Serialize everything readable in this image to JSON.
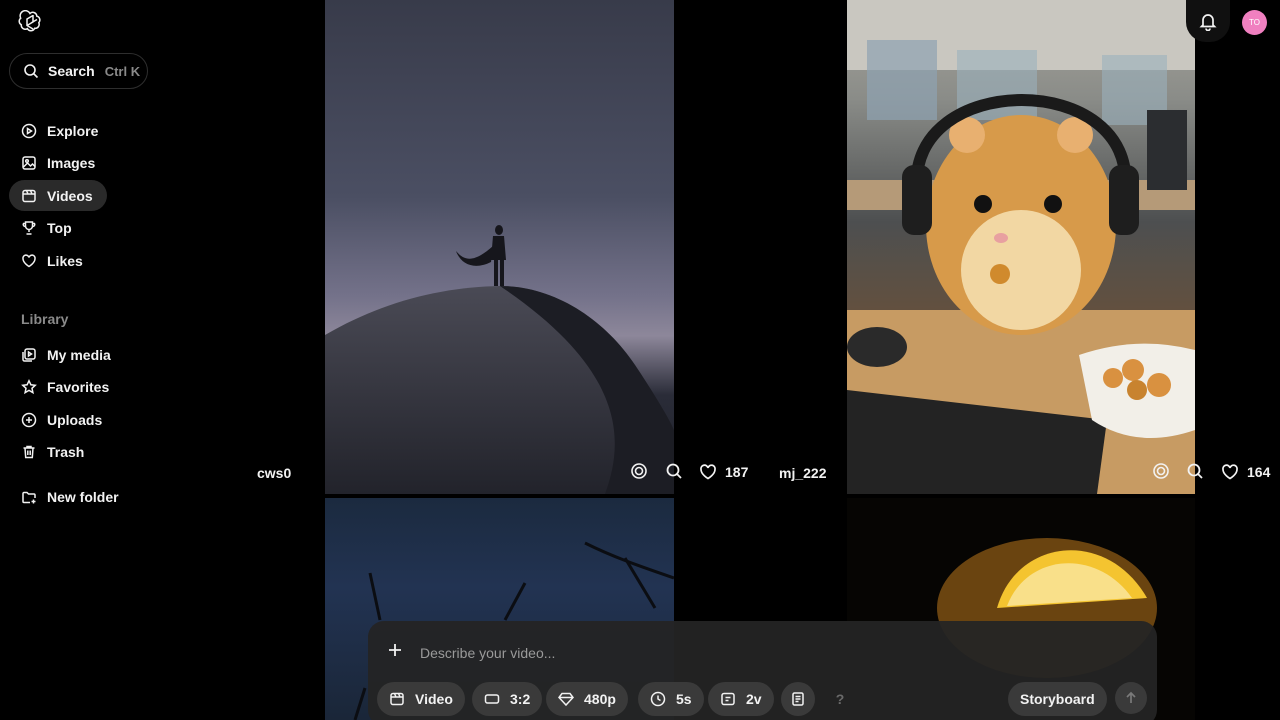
{
  "sidebar": {
    "search": {
      "label": "Search",
      "shortcut": "Ctrl K"
    },
    "items": [
      {
        "label": "Explore",
        "icon": "play-circle-icon"
      },
      {
        "label": "Images",
        "icon": "image-icon"
      },
      {
        "label": "Videos",
        "icon": "video-icon",
        "active": true
      },
      {
        "label": "Top",
        "icon": "trophy-icon"
      },
      {
        "label": "Likes",
        "icon": "heart-icon"
      }
    ],
    "library_label": "Library",
    "library_items": [
      {
        "label": "My media",
        "icon": "media-icon"
      },
      {
        "label": "Favorites",
        "icon": "star-icon"
      },
      {
        "label": "Uploads",
        "icon": "upload-icon"
      },
      {
        "label": "Trash",
        "icon": "trash-icon"
      }
    ],
    "new_folder": "New folder"
  },
  "feed": {
    "cards": [
      {
        "user": "cws0",
        "likes": "187"
      },
      {
        "user": "mj_222",
        "likes": "164"
      }
    ]
  },
  "header": {
    "avatar_initials": "TO",
    "avatar_color": "#f080c0"
  },
  "composer": {
    "placeholder": "Describe your video...",
    "type_label": "Video",
    "aspect_label": "3:2",
    "resolution_label": "480p",
    "duration_label": "5s",
    "variations_label": "2v",
    "help_label": "?",
    "storyboard_label": "Storyboard"
  }
}
